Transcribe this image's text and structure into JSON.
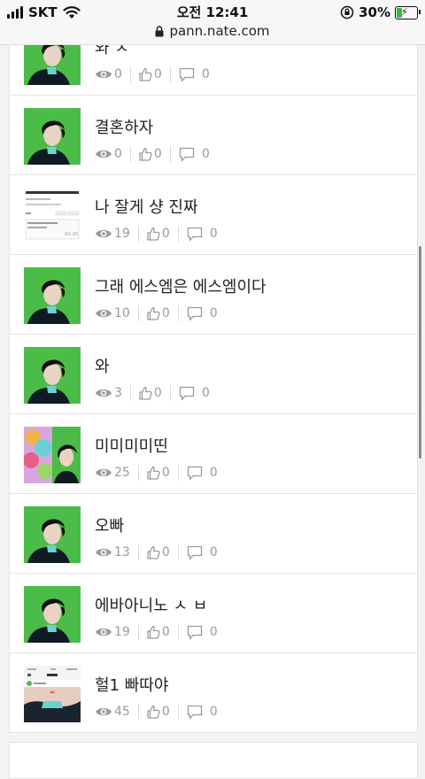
{
  "status_bar": {
    "carrier": "SKT",
    "time": "오전 12:41",
    "battery_percent": "30%",
    "battery_level": 0.3
  },
  "browser": {
    "url": "pann.nate.com"
  },
  "posts": [
    {
      "title": "와 ㅅ",
      "views": "0",
      "likes": "0",
      "comments": "0",
      "thumb": "portrait"
    },
    {
      "title": "결혼하자",
      "views": "0",
      "likes": "0",
      "comments": "0",
      "thumb": "portrait"
    },
    {
      "title": "나 잘게 샹 진짜",
      "views": "19",
      "likes": "0",
      "comments": "0",
      "thumb": "screenshot"
    },
    {
      "title": "그래 에스엠은 에스엠이다",
      "views": "10",
      "likes": "0",
      "comments": "0",
      "thumb": "portrait"
    },
    {
      "title": "와",
      "views": "3",
      "likes": "0",
      "comments": "0",
      "thumb": "portrait"
    },
    {
      "title": "미미미미띤",
      "views": "25",
      "likes": "0",
      "comments": "0",
      "thumb": "collage"
    },
    {
      "title": "오빠",
      "views": "13",
      "likes": "0",
      "comments": "0",
      "thumb": "portrait"
    },
    {
      "title": "에바아니노 ㅅ ㅂ",
      "views": "19",
      "likes": "0",
      "comments": "0",
      "thumb": "portrait"
    },
    {
      "title": "헐1 빠따야",
      "views": "45",
      "likes": "0",
      "comments": "0",
      "thumb": "profile"
    }
  ],
  "icons": {
    "views": "eye-icon",
    "likes": "thumbs-up-icon",
    "comments": "comment-icon"
  },
  "colors": {
    "accent_green": "#49b947",
    "stat_gray": "#9a9a9a"
  }
}
